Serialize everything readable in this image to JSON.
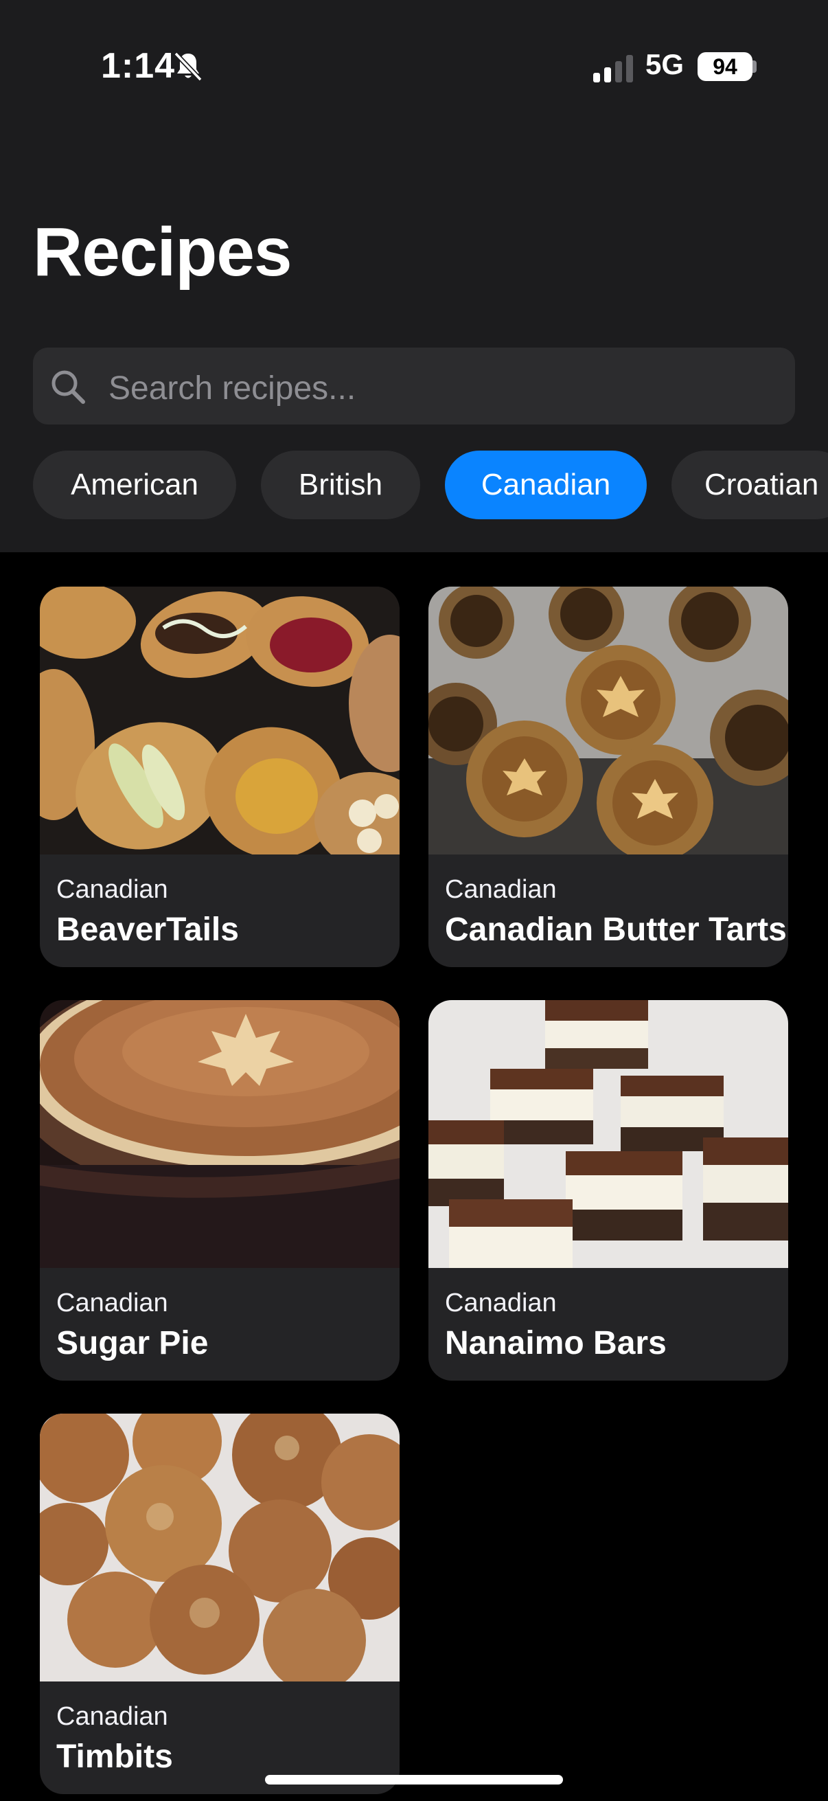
{
  "status_bar": {
    "time": "1:14",
    "network": "5G",
    "battery": "94"
  },
  "header": {
    "title": "Recipes"
  },
  "search": {
    "placeholder": "Search recipes..."
  },
  "filters": {
    "selected": "Canadian",
    "items": [
      {
        "label": "American"
      },
      {
        "label": "British"
      },
      {
        "label": "Canadian"
      },
      {
        "label": "Croatian"
      }
    ]
  },
  "recipes": [
    {
      "cuisine": "Canadian",
      "name": "BeaverTails"
    },
    {
      "cuisine": "Canadian",
      "name": "Canadian Butter Tarts"
    },
    {
      "cuisine": "Canadian",
      "name": "Sugar Pie"
    },
    {
      "cuisine": "Canadian",
      "name": "Nanaimo Bars"
    },
    {
      "cuisine": "Canadian",
      "name": "Timbits"
    }
  ],
  "colors": {
    "accent": "#0a84ff",
    "header_bg": "#1c1c1e",
    "chip_bg": "#2c2c2e",
    "card_bg": "#242426",
    "page_bg": "#000000"
  },
  "icons": {
    "silent": "bell-slash-icon",
    "signal": "cellular-signal-icon",
    "search": "magnifying-glass-icon"
  }
}
